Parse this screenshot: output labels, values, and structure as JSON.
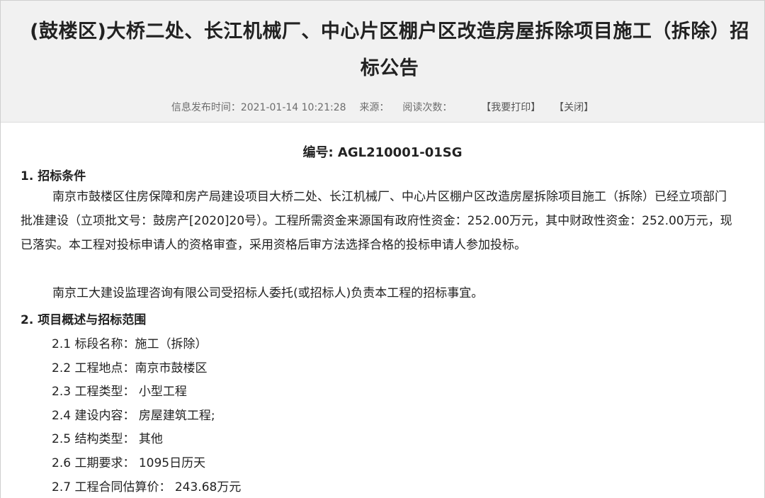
{
  "header": {
    "title": "(鼓楼区)大桥二处、长江机械厂、中心片区棚户区改造房屋拆除项目施工（拆除）招标公告",
    "meta": {
      "publish_label": "信息发布时间：",
      "publish_time": "2021-01-14 10:21:28",
      "source_label": "来源：",
      "read_label": "阅读次数：",
      "print_link": "【我要打印】",
      "close_link": "【关闭】"
    }
  },
  "content": {
    "doc_no": "编号: AGL210001-01SG",
    "section1": {
      "heading": "1. 招标条件",
      "para1": "南京市鼓楼区住房保障和房产局建设项目大桥二处、长江机械厂、中心片区棚户区改造房屋拆除项目施工（拆除）已经立项部门批准建设（立项批文号：鼓房产[2020]20号）。工程所需资金来源国有政府性资金：252.00万元，其中财政性资金：252.00万元，现已落实。本工程对投标申请人的资格审查，采用资格后审方法选择合格的投标申请人参加投标。",
      "para2": "南京工大建设监理咨询有限公司受招标人委托(或招标人)负责本工程的招标事宜。"
    },
    "section2": {
      "heading": "2. 项目概述与招标范围",
      "items": [
        "2.1 标段名称：施工（拆除）",
        "2.2 工程地点：南京市鼓楼区",
        "2.3 工程类型： 小型工程",
        "2.4 建设内容： 房屋建筑工程;",
        "2.5 结构类型： 其他",
        "2.6 工期要求： 1095日历天",
        "2.7 工程合同估算价： 243.68万元"
      ]
    }
  }
}
